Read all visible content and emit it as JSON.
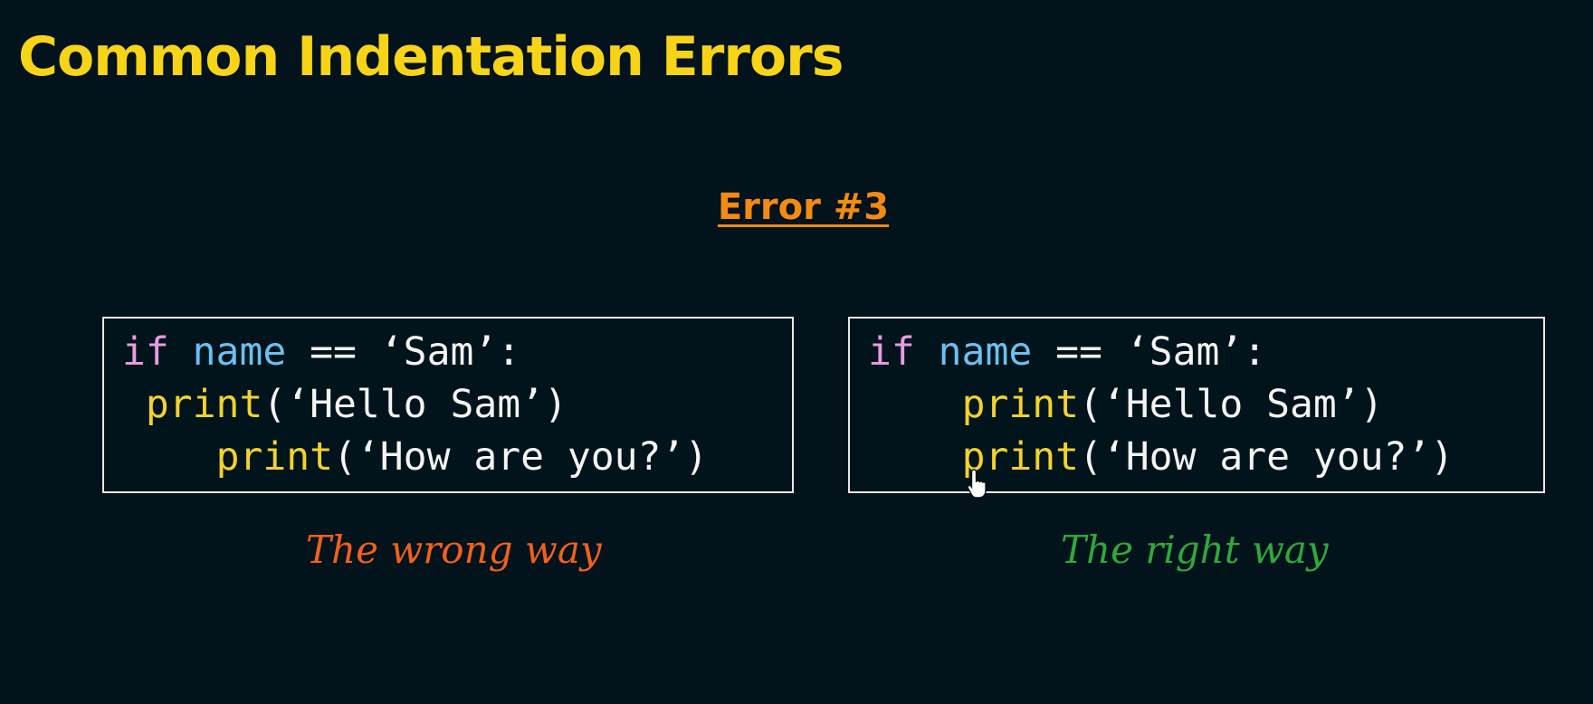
{
  "slide": {
    "title": "Common Indentation Errors",
    "subtitle": "Error #3"
  },
  "colors": {
    "background": "#02131b",
    "title": "#f7d417",
    "subtitle": "#f38a12",
    "keyword": "#e79be0",
    "variable": "#6cc0f0",
    "function": "#f2d22c",
    "wrong_caption": "#f0601d",
    "right_caption": "#2fa83c"
  },
  "wrong_example": {
    "line1": {
      "keyword": "if",
      "variable": "name",
      "rest": " == ‘Sam’:"
    },
    "line2": {
      "indent": " ",
      "function": "print",
      "args": "(‘Hello Sam’)"
    },
    "line3": {
      "indent": "    ",
      "function": "print",
      "args": "(‘How are you?’)"
    },
    "caption": "The wrong way"
  },
  "right_example": {
    "line1": {
      "keyword": "if",
      "variable": "name",
      "rest": " == ‘Sam’:"
    },
    "line2": {
      "indent": "    ",
      "function": "print",
      "args": "(‘Hello Sam’)"
    },
    "line3": {
      "indent": "    ",
      "function": "print",
      "args": "(‘How are you?’)"
    },
    "caption": "The right way"
  },
  "icons": {
    "cursor": "hand-pointer-icon"
  }
}
